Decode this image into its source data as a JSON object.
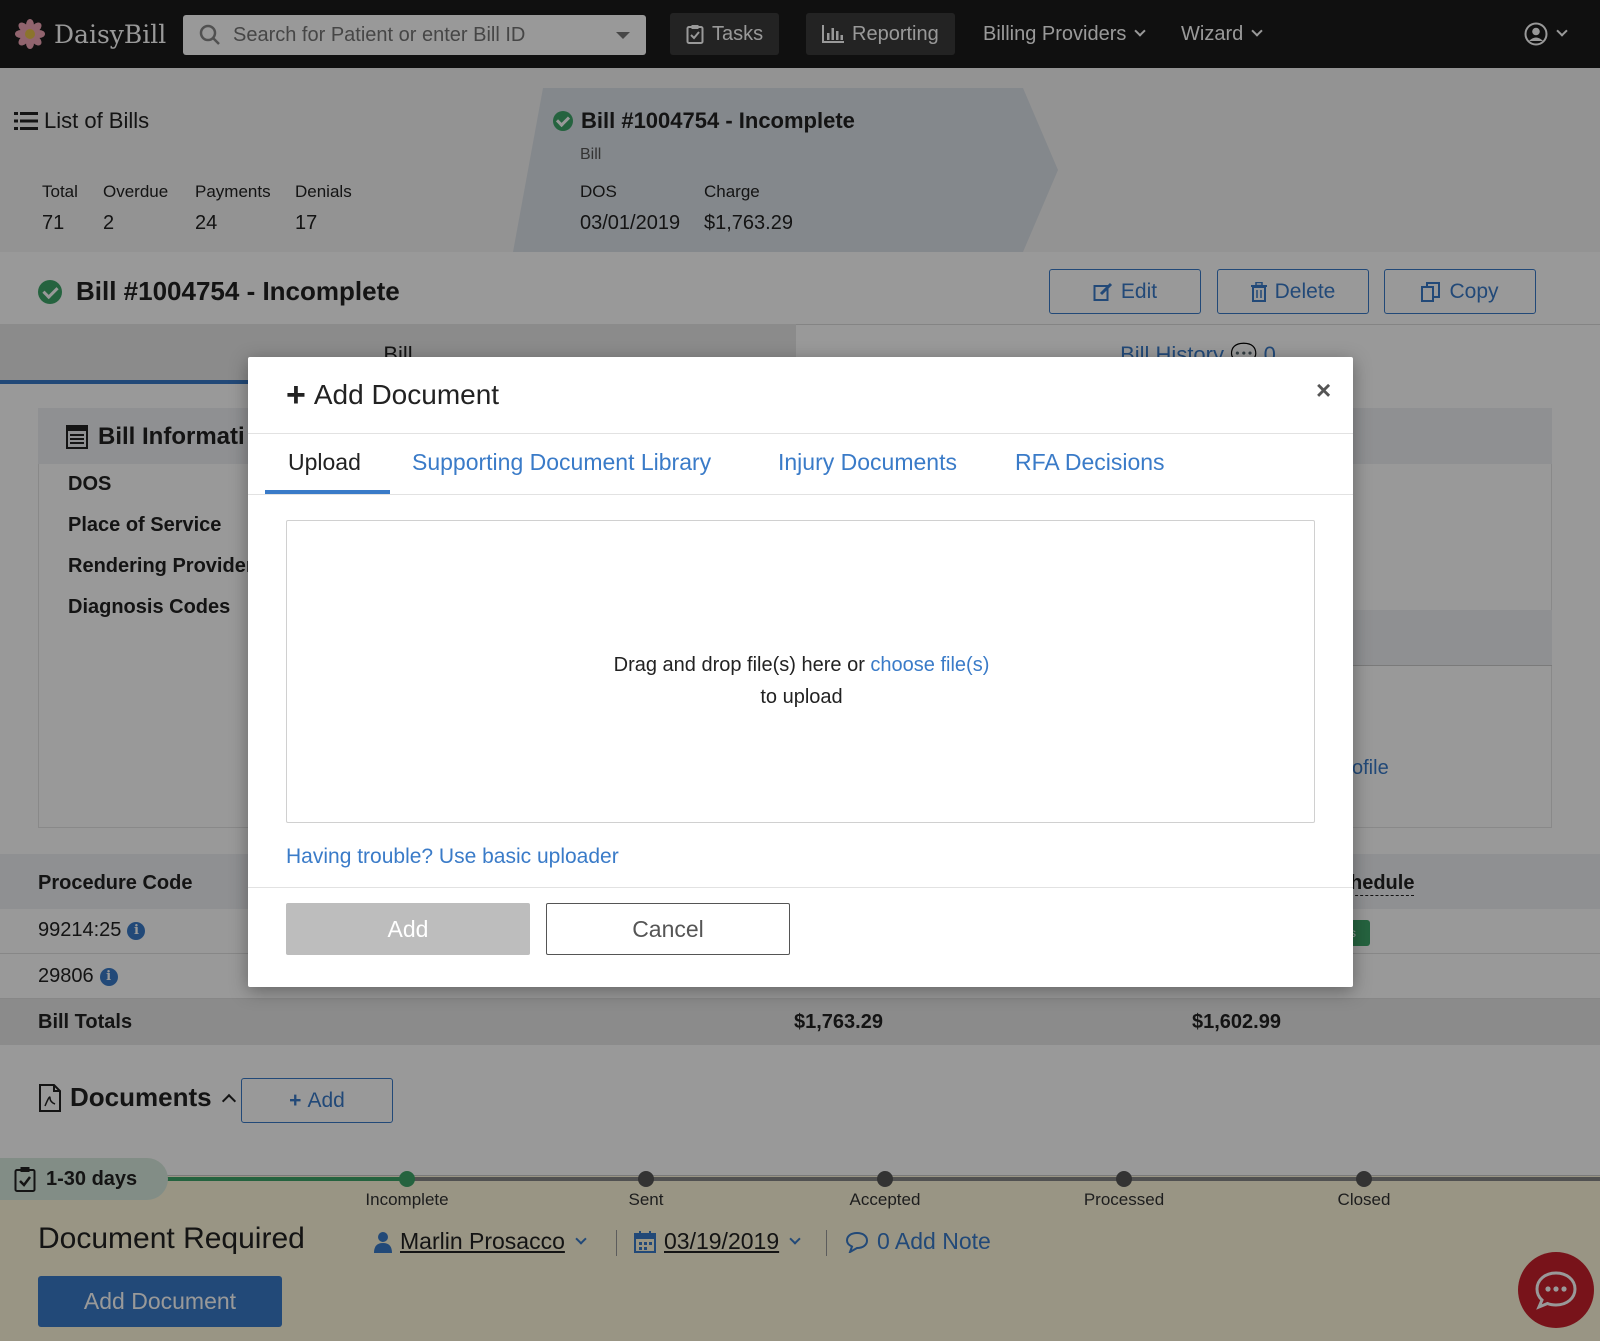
{
  "topnav": {
    "brand": "DaisyBill",
    "search_placeholder": "Search for Patient or enter Bill ID",
    "tasks": "Tasks",
    "reporting": "Reporting",
    "billing_providers": "Billing Providers",
    "wizard": "Wizard"
  },
  "breadcrumb": {
    "list_title": "List of Bills",
    "stats": [
      {
        "label": "Total",
        "value": "71"
      },
      {
        "label": "Overdue",
        "value": "2"
      },
      {
        "label": "Payments",
        "value": "24"
      },
      {
        "label": "Denials",
        "value": "17"
      }
    ],
    "bill_title": "Bill #1004754 - Incomplete",
    "bill_sub": "Bill",
    "dos_label": "DOS",
    "dos_value": "03/01/2019",
    "charge_label": "Charge",
    "charge_value": "$1,763.29"
  },
  "bill": {
    "title": "Bill #1004754 - Incomplete",
    "edit": "Edit",
    "delete": "Delete",
    "copy": "Copy",
    "tab_bill": "Bill",
    "tab_history": "Bill History",
    "history_count": "0"
  },
  "info": {
    "title": "Bill Informati",
    "labels": [
      "DOS",
      "Place of Service",
      "Rendering Provider",
      "Diagnosis Codes"
    ],
    "profile_link": "ofile"
  },
  "procedures": {
    "col_code": "Procedure Code",
    "col_schedule": "hedule",
    "rows": [
      {
        "code": "99214:25",
        "tag": "s"
      },
      {
        "code": "29806"
      }
    ],
    "totals_label": "Bill Totals",
    "total_charge": "$1,763.29",
    "total_schedule": "$1,602.99"
  },
  "documents": {
    "title": "Documents",
    "add": "Add"
  },
  "status": {
    "days": "1-30 days",
    "stages": [
      "Incomplete",
      "Sent",
      "Accepted",
      "Processed",
      "Closed"
    ],
    "current_stage_index": 0,
    "headline": "Document Required",
    "assignee": "Marlin Prosacco",
    "date": "03/19/2019",
    "notes": "0 Add Note",
    "primary_action": "Add Document"
  },
  "modal": {
    "title": "Add Document",
    "close": "×",
    "tabs": [
      "Upload",
      "Supporting Document Library",
      "Injury Documents",
      "RFA Decisions"
    ],
    "active_tab": "Upload",
    "drop_text_before": "Drag and drop file(s) here or",
    "drop_link": "choose file(s)",
    "drop_text_after": "to upload",
    "trouble_link": "Having trouble? Use basic uploader",
    "add_button": "Add",
    "cancel_button": "Cancel"
  },
  "colors": {
    "accent": "#3a7bc8",
    "success": "#3fa66a",
    "nav_bg": "#1c1c1c",
    "chat": "#c8202c"
  }
}
